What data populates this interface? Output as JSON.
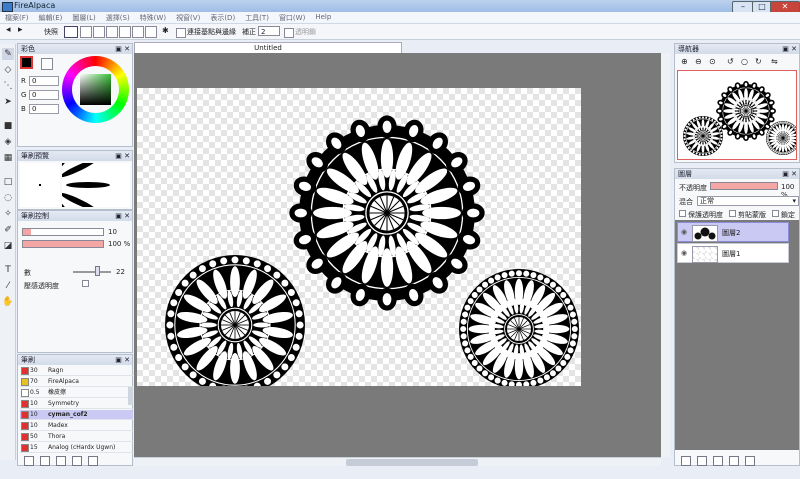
{
  "window": {
    "title": "FireAlpaca",
    "min": "–",
    "max": "□",
    "close": "✕"
  },
  "menubar": [
    "檔案(F)",
    "編輯(E)",
    "圖層(L)",
    "選擇(S)",
    "特殊(W)",
    "視窗(V)",
    "表示(D)",
    "工具(T)",
    "窗口(W)",
    "Help"
  ],
  "toolbar": {
    "brush_label": "快照",
    "antialias_label": "連接基點與邊緣",
    "correction_label": "補正",
    "correction_value": "2",
    "lock_label": "透明鎖"
  },
  "doc_tab": "Untitled",
  "color_panel": {
    "title": "彩色",
    "r_label": "R",
    "r_value": "0",
    "g_label": "G",
    "g_value": "0",
    "b_label": "B",
    "b_value": "0",
    "primary_color": "#000000",
    "secondary_color": "#ffffff"
  },
  "brush_preview": {
    "title": "筆刷預覽"
  },
  "brush_control": {
    "title": "筆刷控制",
    "size_value": "10",
    "opacity_value": "100 %",
    "size_fraction": 0.1,
    "opacity_fraction": 1.0,
    "aa_label": "數",
    "aa_value": "22",
    "pressure_label": "壓感透明度"
  },
  "brush_list": {
    "title": "筆刷",
    "items": [
      {
        "size": "30",
        "name": "Ragn",
        "color": "#e03030",
        "selected": false
      },
      {
        "size": "70",
        "name": "FireAlpaca",
        "color": "#e8c020",
        "selected": false
      },
      {
        "size": "0.5",
        "name": "橡皮擦",
        "color": "#ffffff",
        "selected": false
      },
      {
        "size": "10",
        "name": "Symmetry",
        "color": "#e03030",
        "selected": false
      },
      {
        "size": "10",
        "name": "cyman_cof2",
        "color": "#e03030",
        "selected": true
      },
      {
        "size": "10",
        "name": "Madex",
        "color": "#e03030",
        "selected": false
      },
      {
        "size": "50",
        "name": "Thora",
        "color": "#e03030",
        "selected": false
      },
      {
        "size": "15",
        "name": "Analog (cHardx Ugwn)",
        "color": "#e03030",
        "selected": false
      }
    ]
  },
  "navigator": {
    "title": "導航器"
  },
  "layers_panel": {
    "title": "圖層",
    "opacity_label": "不透明度",
    "opacity_value": "100 %",
    "opacity_fraction": 1.0,
    "blend_label": "混合",
    "blend_value": "正常",
    "protect_label": "保護透明度",
    "clip_label": "剪貼蒙版",
    "lock_label": "鎖定",
    "layers": [
      {
        "name": "圖層2",
        "selected": true
      },
      {
        "name": "圖層1",
        "selected": false
      }
    ]
  },
  "colors": {
    "accent": "#c9c9f4",
    "bar_fill": "#f4a6a4",
    "workspace": "#7a7a7a"
  }
}
